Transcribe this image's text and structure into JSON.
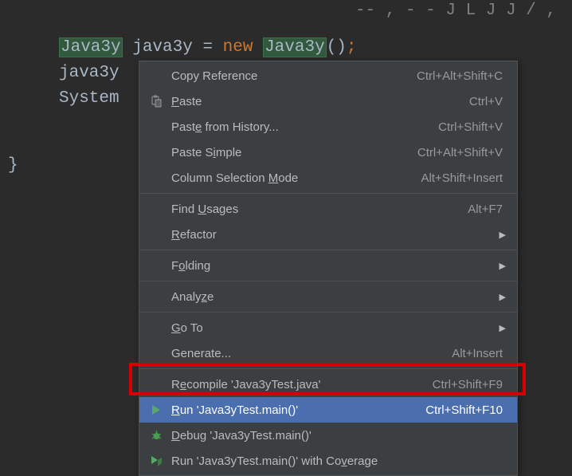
{
  "code": {
    "cls1": "Java3y",
    "var": " java3y ",
    "eq": "=",
    "kw_new": " new ",
    "cls2": "Java3y",
    "paren": "()",
    "semi": ";",
    "line2": "java3y",
    "line3": "System"
  },
  "brace": "}",
  "menu": {
    "copy_ref": "Copy Reference",
    "copy_ref_sc": "Ctrl+Alt+Shift+C",
    "paste": "Paste",
    "paste_sc": "Ctrl+V",
    "paste_hist": "Paste from History...",
    "paste_hist_sc": "Ctrl+Shift+V",
    "paste_simple": "Paste Simple",
    "paste_simple_sc": "Ctrl+Alt+Shift+V",
    "col_sel": "Column Selection Mode",
    "col_sel_sc": "Alt+Shift+Insert",
    "find_usages": "Find Usages",
    "find_usages_sc": "Alt+F7",
    "refactor": "Refactor",
    "folding": "Folding",
    "analyze": "Analyze",
    "goto": "Go To",
    "generate": "Generate...",
    "generate_sc": "Alt+Insert",
    "recompile": "Recompile 'Java3yTest.java'",
    "recompile_sc": "Ctrl+Shift+F9",
    "run": "Run 'Java3yTest.main()'",
    "run_sc": "Ctrl+Shift+F10",
    "debug": "Debug 'Java3yTest.main()'",
    "run_cov": "Run 'Java3yTest.main()' with Coverage"
  }
}
